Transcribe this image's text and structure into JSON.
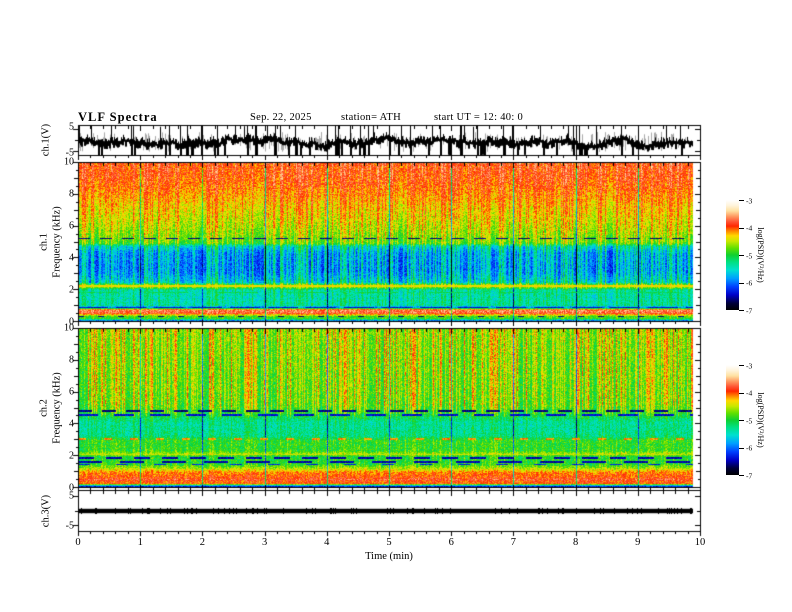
{
  "header": {
    "title": "VLF  Spectra",
    "date": "Sep. 22, 2025",
    "station": "station= ATH",
    "start_ut": "start UT  =   12: 40: 0"
  },
  "panels": {
    "wave": {
      "ylabel": "ch.1(V)",
      "yticks": [
        "5",
        "-5"
      ]
    },
    "spec1": {
      "ylabel1": "ch.1",
      "ylabel2": "Frequency  (kHz)",
      "yticks": [
        "10",
        "8",
        "6",
        "4",
        "2",
        "0"
      ]
    },
    "spec2": {
      "ylabel1": "ch.2",
      "ylabel2": "Frequency  (kHz)",
      "yticks": [
        "10",
        "8",
        "6",
        "4",
        "2",
        "0"
      ]
    },
    "ch3": {
      "ylabel": "ch.3(V)",
      "yticks": [
        "5",
        "-5"
      ]
    }
  },
  "xaxis": {
    "label": "Time  (min)",
    "ticks": [
      "0",
      "1",
      "2",
      "3",
      "4",
      "5",
      "6",
      "7",
      "8",
      "9",
      "10"
    ],
    "range": [
      0,
      10
    ]
  },
  "colorbar": {
    "label": "log(PSD)(V²/Hz)",
    "ticks": [
      "-3",
      "-4",
      "-5",
      "-6",
      "-7"
    ],
    "range": [
      -7,
      -3
    ],
    "palette": [
      {
        "v": -7.0,
        "c": "#000000"
      },
      {
        "v": -6.75,
        "c": "#00003a"
      },
      {
        "v": -6.45,
        "c": "#0000c8"
      },
      {
        "v": -6.15,
        "c": "#0040ff"
      },
      {
        "v": -5.85,
        "c": "#00a0ff"
      },
      {
        "v": -5.55,
        "c": "#00e0d0"
      },
      {
        "v": -5.25,
        "c": "#00e080"
      },
      {
        "v": -5.0,
        "c": "#10d030"
      },
      {
        "v": -4.75,
        "c": "#60e000"
      },
      {
        "v": -4.5,
        "c": "#c8e800"
      },
      {
        "v": -4.3,
        "c": "#ffd800"
      },
      {
        "v": -4.1,
        "c": "#ff7800"
      },
      {
        "v": -3.95,
        "c": "#ff2800"
      },
      {
        "v": -3.8,
        "c": "#ff5030"
      },
      {
        "v": -3.6,
        "c": "#ff9860"
      },
      {
        "v": -3.4,
        "c": "#ffe0a0"
      },
      {
        "v": -3.2,
        "c": "#fff4dc"
      },
      {
        "v": -3.0,
        "c": "#ffffff"
      }
    ]
  },
  "chart_data": [
    {
      "id": "ch1_waveform",
      "type": "line",
      "ylabel": "ch.1(V)",
      "ylim": [
        -5,
        5
      ],
      "yticks": [
        5,
        -5
      ],
      "x_range_min": [
        0,
        9.88
      ],
      "signal": "broadband black noise trace, mean near -0.4 V, envelope about ±2 V, frequent impulsive spikes clipped at ±5 V, gray vertical burst bands",
      "mean_level": -0.4
    },
    {
      "id": "ch1_spectrogram",
      "type": "heatmap",
      "ylabel": "ch.1 Frequency (kHz)",
      "ylim": [
        0,
        10
      ],
      "yticks": [
        0,
        2,
        4,
        6,
        8,
        10
      ],
      "x_range_min": [
        0,
        9.88
      ],
      "value_range": [
        -7,
        -3
      ],
      "texture": "dense vertical impulsive streaks (sferics) over banded background",
      "profile_f_kHz_vs_logPSD": [
        [
          0.0,
          -5.4
        ],
        [
          0.12,
          -6.0
        ],
        [
          0.22,
          -5.0
        ],
        [
          0.38,
          -4.9
        ],
        [
          0.5,
          -4.3
        ],
        [
          0.58,
          -3.8
        ],
        [
          0.78,
          -3.75
        ],
        [
          0.88,
          -5.2
        ],
        [
          0.95,
          -6.1
        ],
        [
          1.05,
          -5.45
        ],
        [
          1.6,
          -5.5
        ],
        [
          2.05,
          -5.45
        ],
        [
          2.28,
          -4.45
        ],
        [
          2.5,
          -5.75
        ],
        [
          3.2,
          -6.05
        ],
        [
          4.3,
          -6.0
        ],
        [
          4.75,
          -5.7
        ],
        [
          4.95,
          -4.95
        ],
        [
          5.6,
          -4.75
        ],
        [
          6.5,
          -4.55
        ],
        [
          7.3,
          -4.4
        ],
        [
          8.2,
          -4.2
        ],
        [
          9.0,
          -4.05
        ],
        [
          10.0,
          -4.0
        ]
      ],
      "streak_gain_vs_f": [
        [
          0.0,
          0.25
        ],
        [
          0.9,
          0.25
        ],
        [
          1.1,
          0.5
        ],
        [
          2.2,
          0.5
        ],
        [
          2.45,
          1.05
        ],
        [
          4.7,
          1.05
        ],
        [
          5.0,
          0.75
        ],
        [
          6.0,
          0.7
        ],
        [
          8.0,
          0.55
        ],
        [
          10.0,
          0.5
        ]
      ],
      "spectral_lines": [
        {
          "f_kHz": 5.25,
          "logPSD": -6.6,
          "dash": [
            12,
            10
          ],
          "th": 1
        },
        {
          "f_kHz": 2.3,
          "logPSD": -4.35,
          "dash": [
            600,
            1
          ],
          "th": 2
        },
        {
          "f_kHz": 1.9,
          "logPSD": -5.1,
          "dash": [
            40,
            30
          ],
          "th": 1
        },
        {
          "f_kHz": 0.92,
          "logPSD": -6.4,
          "dash": [
            30,
            8
          ],
          "th": 1
        },
        {
          "f_kHz": 0.35,
          "logPSD": -6.6,
          "dash": [
            6,
            14
          ],
          "th": 1
        }
      ],
      "seed": 101
    },
    {
      "id": "ch2_spectrogram",
      "type": "heatmap",
      "ylabel": "ch.2 Frequency (kHz)",
      "ylim": [
        0,
        10
      ],
      "yticks": [
        0,
        2,
        4,
        6,
        8,
        10
      ],
      "x_range_min": [
        0,
        9.88
      ],
      "value_range": [
        -7,
        -3
      ],
      "texture": "green background with yellow/red vertical streaks above 5 kHz, cyan band 3.3-4.4 kHz, strong red band below 1 kHz, dark dashed interference lines",
      "profile_f_kHz_vs_logPSD": [
        [
          0.0,
          -6.7
        ],
        [
          0.15,
          -6.3
        ],
        [
          0.3,
          -4.0
        ],
        [
          0.45,
          -4.05
        ],
        [
          0.55,
          -3.8
        ],
        [
          0.65,
          -4.0
        ],
        [
          1.0,
          -4.15
        ],
        [
          1.25,
          -4.6
        ],
        [
          1.5,
          -5.0
        ],
        [
          2.0,
          -5.05
        ],
        [
          2.15,
          -4.6
        ],
        [
          2.35,
          -5.0
        ],
        [
          3.0,
          -5.0
        ],
        [
          3.3,
          -5.35
        ],
        [
          4.1,
          -5.4
        ],
        [
          4.55,
          -5.15
        ],
        [
          4.9,
          -5.0
        ],
        [
          5.3,
          -4.9
        ],
        [
          7.0,
          -4.85
        ],
        [
          9.0,
          -4.8
        ],
        [
          10.0,
          -4.75
        ]
      ],
      "streak_gain_vs_f": [
        [
          0.0,
          0.2
        ],
        [
          1.2,
          0.2
        ],
        [
          1.4,
          0.35
        ],
        [
          4.4,
          0.35
        ],
        [
          4.8,
          0.8
        ],
        [
          5.2,
          0.95
        ],
        [
          10.0,
          0.9
        ]
      ],
      "spectral_lines": [
        {
          "f_kHz": 4.9,
          "logPSD": -6.6,
          "dash": [
            14,
            10
          ],
          "th": 2
        },
        {
          "f_kHz": 4.6,
          "logPSD": -6.4,
          "dash": [
            20,
            16
          ],
          "th": 2
        },
        {
          "f_kHz": 3.12,
          "logPSD": -4.15,
          "dash": [
            8,
            18
          ],
          "th": 2
        },
        {
          "f_kHz": 2.1,
          "logPSD": -4.5,
          "dash": [
            60,
            8
          ],
          "th": 1
        },
        {
          "f_kHz": 1.92,
          "logPSD": -6.5,
          "dash": [
            16,
            12
          ],
          "th": 2
        },
        {
          "f_kHz": 1.68,
          "logPSD": -6.5,
          "dash": [
            24,
            18
          ],
          "th": 2
        },
        {
          "f_kHz": 1.5,
          "logPSD": -6.3,
          "dash": [
            12,
            26
          ],
          "th": 1
        }
      ],
      "seed": 202
    },
    {
      "id": "ch3_waveform",
      "type": "line",
      "ylabel": "ch.3(V)",
      "ylim": [
        -5,
        5
      ],
      "yticks": [
        5,
        -5
      ],
      "x_range_min": [
        0,
        9.88
      ],
      "signal": "flat thick black line at 0 V (inactive channel)",
      "mean_level": 0
    }
  ]
}
